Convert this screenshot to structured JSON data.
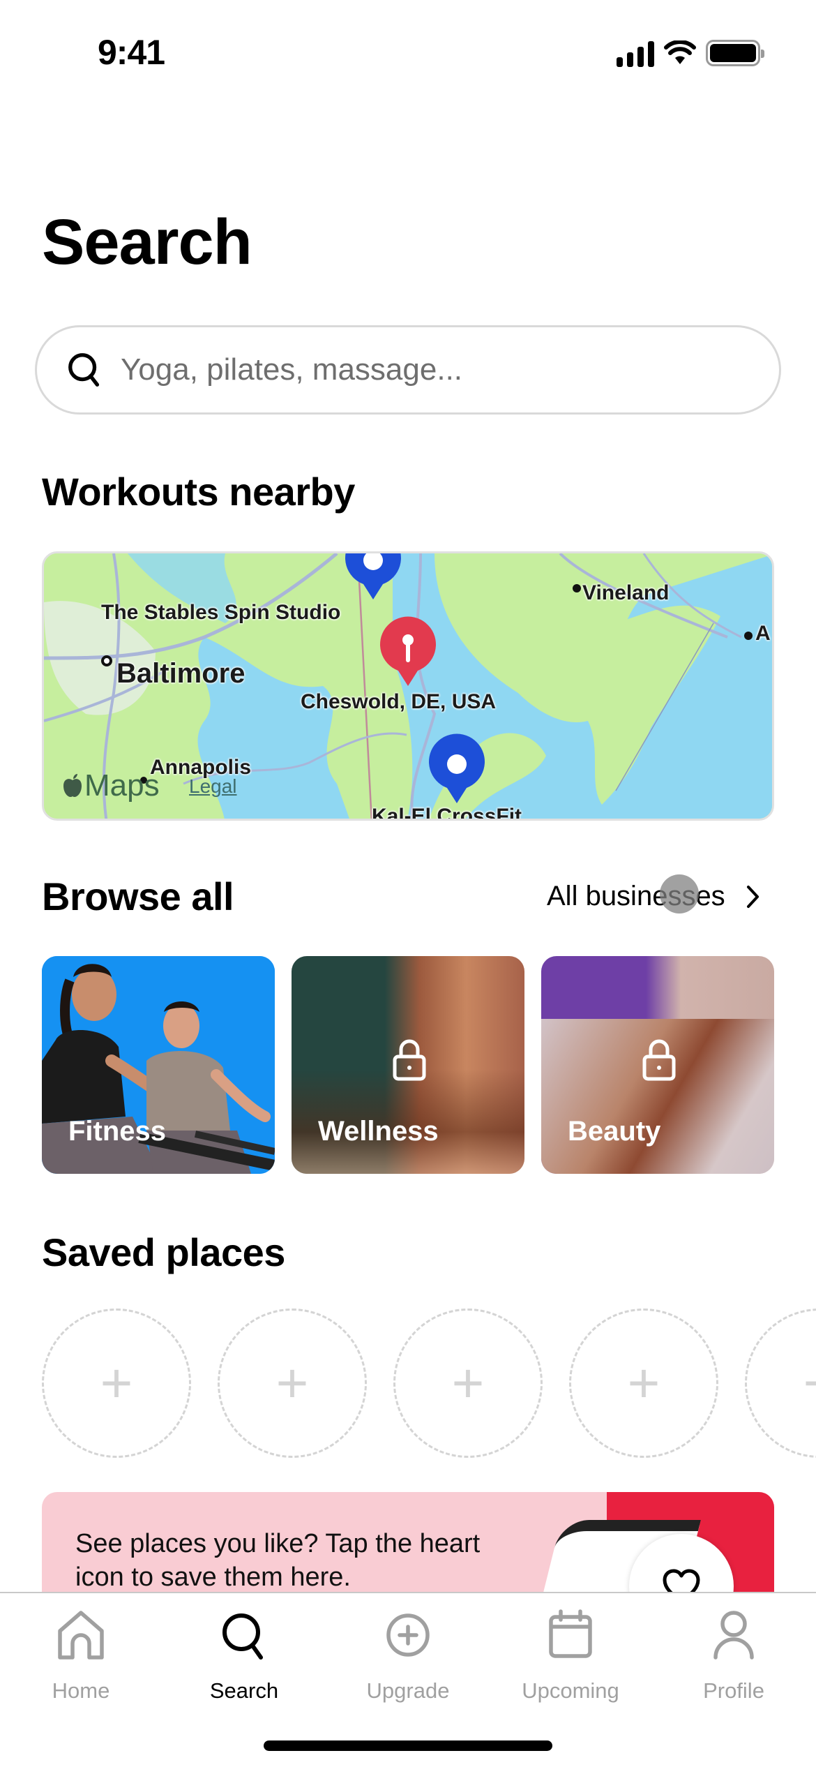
{
  "status_bar": {
    "time": "9:41"
  },
  "page": {
    "title": "Search"
  },
  "search": {
    "placeholder": "Yoga, pilates, massage..."
  },
  "workouts_nearby": {
    "title": "Workouts nearby",
    "map": {
      "labels": {
        "studio_1": "The Stables Spin Studio",
        "city_baltimore": "Baltimore",
        "location": "Cheswold, DE, USA",
        "city_vineland": "Vineland",
        "city_atlantic_partial": "A",
        "city_annapolis": "Annapolis",
        "studio_2": "Kal-El CrossFit"
      },
      "attribution": "Maps",
      "legal_link": "Legal",
      "pins": [
        {
          "type": "studio",
          "color": "#1d4fd8"
        },
        {
          "type": "current-location",
          "color": "#e23a4e"
        },
        {
          "type": "studio",
          "color": "#1d4fd8"
        }
      ]
    }
  },
  "browse": {
    "title": "Browse all",
    "link_label": "All businesses",
    "categories": [
      {
        "label": "Fitness",
        "locked": false
      },
      {
        "label": "Wellness",
        "locked": true
      },
      {
        "label": "Beauty",
        "locked": true
      }
    ]
  },
  "saved_places": {
    "title": "Saved places",
    "empty_slots": 5
  },
  "promo": {
    "text": "See places you like? Tap the heart icon to save them here.",
    "accent_color": "#e8213f",
    "background_color": "#f9ccd3"
  },
  "tab_bar": {
    "tabs": [
      {
        "label": "Home",
        "icon": "home-icon",
        "active": false
      },
      {
        "label": "Search",
        "icon": "search-icon",
        "active": true
      },
      {
        "label": "Upgrade",
        "icon": "plus-circle-icon",
        "active": false
      },
      {
        "label": "Upcoming",
        "icon": "calendar-icon",
        "active": false
      },
      {
        "label": "Profile",
        "icon": "profile-icon",
        "active": false
      }
    ]
  }
}
